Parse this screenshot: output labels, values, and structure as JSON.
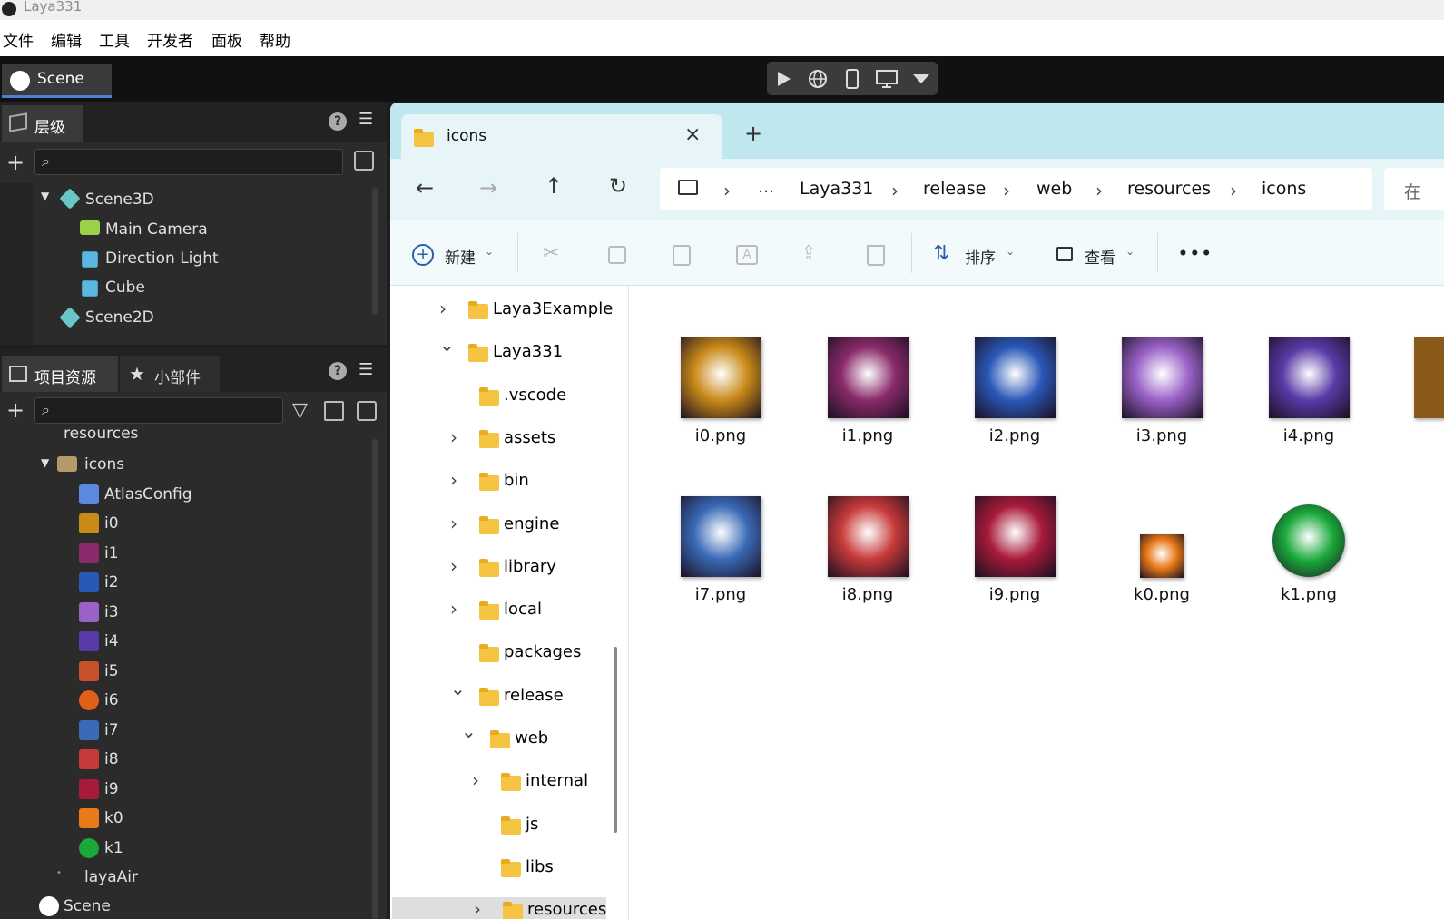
{
  "window": {
    "title": "Laya331"
  },
  "menu": [
    "文件",
    "编辑",
    "工具",
    "开发者",
    "面板",
    "帮助"
  ],
  "scene_tab": {
    "label": "Scene"
  },
  "hierarchy": {
    "tab_label": "层级",
    "items": [
      {
        "label": "Scene3D"
      },
      {
        "label": "Main Camera"
      },
      {
        "label": "Direction Light"
      },
      {
        "label": "Cube"
      },
      {
        "label": "Scene2D"
      }
    ]
  },
  "assets_panel": {
    "tab_project": "项目资源",
    "tab_widgets": "小部件",
    "partial_top": "resources",
    "folder": "icons",
    "items": [
      "AtlasConfig",
      "i0",
      "i1",
      "i2",
      "i3",
      "i4",
      "i5",
      "i6",
      "i7",
      "i8",
      "i9",
      "k0",
      "k1"
    ],
    "after": [
      "layaAir",
      "Scene"
    ]
  },
  "explorer": {
    "tab_title": "icons",
    "new_tab": "+",
    "breadcrumb": [
      "…",
      "Laya331",
      "release",
      "web",
      "resources",
      "icons"
    ],
    "search_partial": "在",
    "commands": {
      "new": "新建",
      "sort": "排序",
      "view": "查看",
      "more": "•••"
    },
    "nav_tree": [
      {
        "label": "Laya3Example",
        "chev": "›"
      },
      {
        "label": "Laya331",
        "chev": "⌄"
      },
      {
        "label": ".vscode",
        "chev": ""
      },
      {
        "label": "assets",
        "chev": "›"
      },
      {
        "label": "bin",
        "chev": "›"
      },
      {
        "label": "engine",
        "chev": "›"
      },
      {
        "label": "library",
        "chev": "›"
      },
      {
        "label": "local",
        "chev": "›"
      },
      {
        "label": "packages",
        "chev": ""
      },
      {
        "label": "release",
        "chev": "⌄"
      },
      {
        "label": "web",
        "chev": "⌄"
      },
      {
        "label": "internal",
        "chev": "›"
      },
      {
        "label": "js",
        "chev": ""
      },
      {
        "label": "libs",
        "chev": ""
      },
      {
        "label": "resources",
        "chev": "›"
      }
    ],
    "files": [
      {
        "name": "i0.png",
        "color": "#c98a18"
      },
      {
        "name": "i1.png",
        "color": "#8a2a6a"
      },
      {
        "name": "i2.png",
        "color": "#2a58b8"
      },
      {
        "name": "i3.png",
        "color": "#9a62c8"
      },
      {
        "name": "i4.png",
        "color": "#5a3aa8"
      },
      {
        "name": "i7.png",
        "color": "#3a6ab8"
      },
      {
        "name": "i8.png",
        "color": "#c83a3a"
      },
      {
        "name": "i9.png",
        "color": "#a81a3a"
      },
      {
        "name": "k0.png",
        "color": "#e87a1a"
      },
      {
        "name": "k1.png",
        "color": "#1aa83a"
      }
    ]
  }
}
